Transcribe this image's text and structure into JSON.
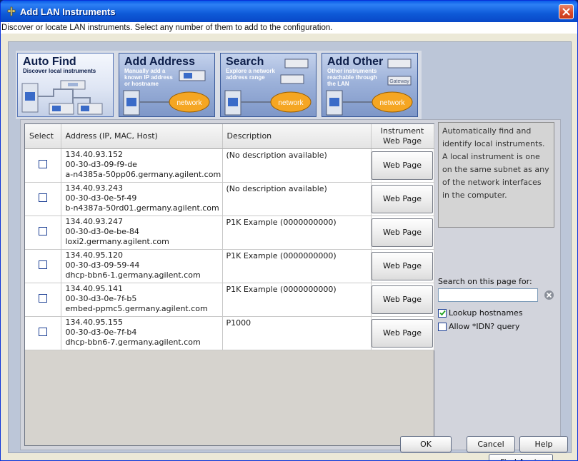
{
  "window": {
    "title": "Add LAN Instruments",
    "subtitle": "Discover or locate LAN instruments. Select any number of them to add to the configuration."
  },
  "tabs": [
    {
      "title": "Auto Find",
      "desc": "Discover local instruments",
      "active": true
    },
    {
      "title": "Add Address",
      "desc": "Manually add a known IP address or hostname",
      "badge": "network",
      "active": false
    },
    {
      "title": "Search",
      "desc": "Explore a network address range",
      "badge": "network",
      "active": false
    },
    {
      "title": "Add Other",
      "desc": "Other instruments reachable through the LAN",
      "badge": "network",
      "gateway": "Gateway",
      "active": false
    }
  ],
  "table": {
    "headers": {
      "select": "Select",
      "address": "Address (IP, MAC, Host)",
      "description": "Description",
      "webpage_line1": "Instrument",
      "webpage_line2": "Web Page"
    },
    "rows": [
      {
        "ip": "134.40.93.152",
        "mac": "00-30-d3-09-f9-de",
        "host": "a-n4385a-50pp06.germany.agilent.com",
        "description": "(No description available)",
        "button": "Web Page",
        "selected": false
      },
      {
        "ip": "134.40.93.243",
        "mac": "00-30-d3-0e-5f-49",
        "host": "b-n4387a-50rd01.germany.agilent.com",
        "description": "(No description available)",
        "button": "Web Page",
        "selected": false
      },
      {
        "ip": "134.40.93.247",
        "mac": "00-30-d3-0e-be-84",
        "host": "loxi2.germany.agilent.com",
        "description": "P1K Example (0000000000)",
        "button": "Web Page",
        "selected": false
      },
      {
        "ip": "134.40.95.120",
        "mac": "00-30-d3-09-59-44",
        "host": "dhcp-bbn6-1.germany.agilent.com",
        "description": "P1K Example (0000000000)",
        "button": "Web Page",
        "selected": false
      },
      {
        "ip": "134.40.95.141",
        "mac": "00-30-d3-0e-7f-b5",
        "host": "embed-ppmc5.germany.agilent.com",
        "description": "P1K Example (0000000000)",
        "button": "Web Page",
        "selected": false
      },
      {
        "ip": "134.40.95.155",
        "mac": "00-30-d3-0e-7f-b4",
        "host": "dhcp-bbn6-7.germany.agilent.com",
        "description": "P1000",
        "button": "Web Page",
        "selected": false
      }
    ]
  },
  "side": {
    "help_text": "Automatically find and identify local instruments. A local instrument is one on the same subnet as any of the network interfaces in the computer.",
    "search_label": "Search on this page for:",
    "search_value": "",
    "lookup_hostnames_label": "Lookup hostnames",
    "lookup_hostnames_checked": true,
    "allow_idn_label": "Allow *IDN? query",
    "allow_idn_checked": false,
    "find_again_label": "Find Again"
  },
  "buttons": {
    "ok": "OK",
    "cancel": "Cancel",
    "help": "Help"
  },
  "colors": {
    "titlebar": "#0a5ce8",
    "network_badge": "#f5a623",
    "panel": "#d2d4dc"
  }
}
